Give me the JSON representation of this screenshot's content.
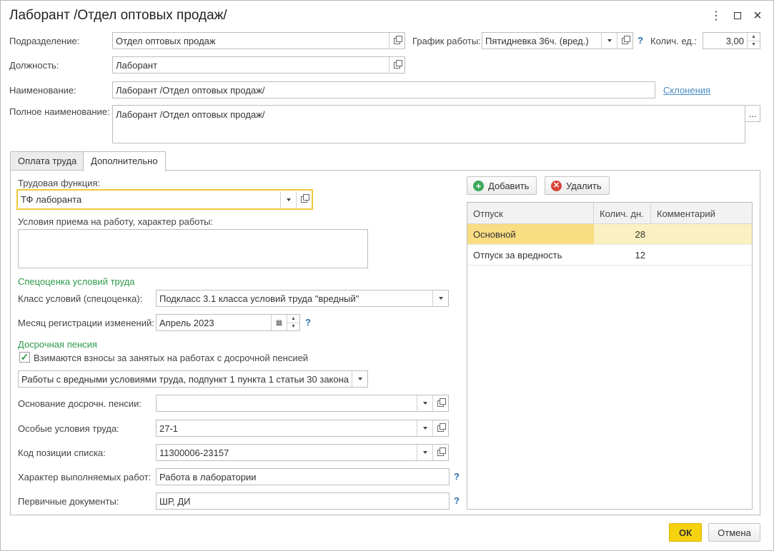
{
  "window": {
    "title": "Лаборант /Отдел оптовых продаж/",
    "controls": [
      "more-icon",
      "maximize-icon",
      "close-icon"
    ]
  },
  "header": {
    "department_label": "Подразделение:",
    "department_value": "Отдел оптовых продаж",
    "schedule_label": "График работы:",
    "schedule_value": "Пятидневка 36ч. (вред.)",
    "units_label": "Колич. ед.:",
    "units_value": "3,00",
    "position_label": "Должность:",
    "position_value": "Лаборант",
    "name_label": "Наименование:",
    "name_value": "Лаборант /Отдел оптовых продаж/",
    "declensions_link": "Склонения",
    "full_name_label": "Полное наименование:",
    "full_name_value": "Лаборант /Отдел оптовых продаж/",
    "more_button": "...",
    "help": "?"
  },
  "tabs": [
    {
      "label": "Оплата труда",
      "active": false
    },
    {
      "label": "Дополнительно",
      "active": true
    }
  ],
  "left": {
    "labor_function_label": "Трудовая функция:",
    "labor_function_value": "ТФ лаборанта",
    "conditions_label": "Условия приема на работу, характер работы:",
    "conditions_value": "",
    "special_assessment_header": "Спецоценка условий труда",
    "class_label": "Класс условий (спецоценка):",
    "class_value": "Подкласс 3.1 класса условий труда \"вредный\"",
    "month_label": "Месяц регистрации изменений:",
    "month_value": "Апрель 2023",
    "early_pension_header": "Досрочная пенсия",
    "contributions_checkbox_label": "Взимаются взносы за занятых на работах с досрочной пенсией",
    "contributions_checked": true,
    "works_value": "Работы с вредными условиями труда, подпункт 1 пункта 1 статьи 30 закона",
    "basis_label": "Основание досрочн. пенсии:",
    "basis_value": "",
    "special_conditions_label": "Особые условия труда:",
    "special_conditions_value": "27-1",
    "list_code_label": "Код позиции списка:",
    "list_code_value": "11300006-23157",
    "work_nature_label": "Характер выполняемых работ:",
    "work_nature_value": "Работа в лаборатории",
    "primary_docs_label": "Первичные документы:",
    "primary_docs_value": "ШР, ДИ"
  },
  "right": {
    "add_button": "Добавить",
    "delete_button": "Удалить",
    "columns": [
      "Отпуск",
      "Колич. дн.",
      "Комментарий"
    ],
    "rows": [
      {
        "vacation": "Основной",
        "days": "28",
        "comment": ""
      },
      {
        "vacation": "Отпуск за вредность",
        "days": "12",
        "comment": ""
      }
    ]
  },
  "footer": {
    "ok": "ОК",
    "cancel": "Отмена"
  },
  "colors": {
    "accent_yellow": "#f5d20e",
    "section_green": "#2e9a4a",
    "link_blue": "#4a8bc2",
    "selected_row": "#fbf0c1"
  }
}
